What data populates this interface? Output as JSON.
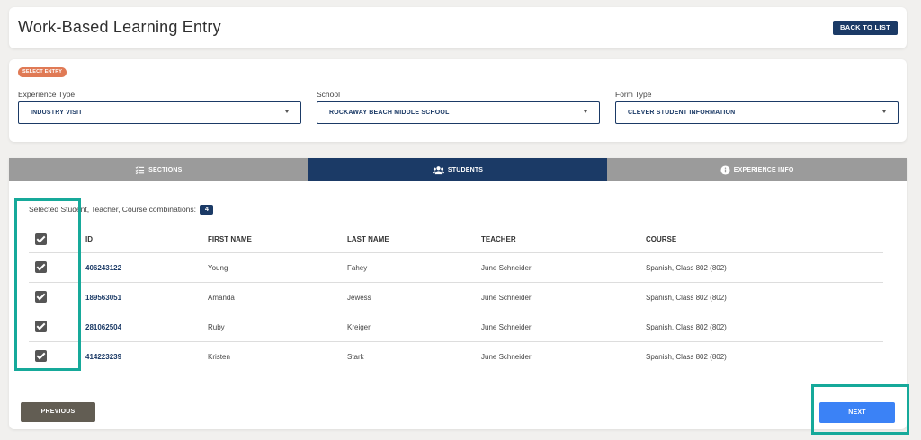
{
  "header": {
    "title": "Work-Based Learning Entry",
    "back_label": "BACK TO LIST"
  },
  "entry": {
    "badge": "SELECT ENTRY",
    "fields": [
      {
        "label": "Experience Type",
        "value": "INDUSTRY VISIT"
      },
      {
        "label": "School",
        "value": "ROCKAWAY BEACH MIDDLE SCHOOL"
      },
      {
        "label": "Form Type",
        "value": "CLEVER STUDENT INFORMATION"
      }
    ]
  },
  "tabs": [
    {
      "label": "SECTIONS",
      "icon": "list-check-icon",
      "active": false
    },
    {
      "label": "STUDENTS",
      "icon": "users-icon",
      "active": true
    },
    {
      "label": "EXPERIENCE INFO",
      "icon": "info-icon",
      "active": false
    }
  ],
  "selection": {
    "text": "Selected Student, Teacher, Course combinations:",
    "count": "4"
  },
  "table": {
    "columns": [
      "ID",
      "FIRST NAME",
      "LAST NAME",
      "TEACHER",
      "COURSE"
    ],
    "rows": [
      {
        "id": "406243122",
        "first": "Young",
        "last": "Fahey",
        "teacher": "June Schneider",
        "course": "Spanish, Class 802 (802)",
        "checked": true
      },
      {
        "id": "189563051",
        "first": "Amanda",
        "last": "Jewess",
        "teacher": "June Schneider",
        "course": "Spanish, Class 802 (802)",
        "checked": true
      },
      {
        "id": "281062504",
        "first": "Ruby",
        "last": "Kreiger",
        "teacher": "June Schneider",
        "course": "Spanish, Class 802 (802)",
        "checked": true
      },
      {
        "id": "414223239",
        "first": "Kristen",
        "last": "Stark",
        "teacher": "June Schneider",
        "course": "Spanish, Class 802 (802)",
        "checked": true
      }
    ]
  },
  "footer": {
    "previous_label": "PREVIOUS",
    "next_label": "NEXT"
  },
  "colors": {
    "primary": "#1b3a66",
    "accent": "#3b82f6",
    "badge": "#e07a55",
    "highlight": "#16a99a"
  }
}
